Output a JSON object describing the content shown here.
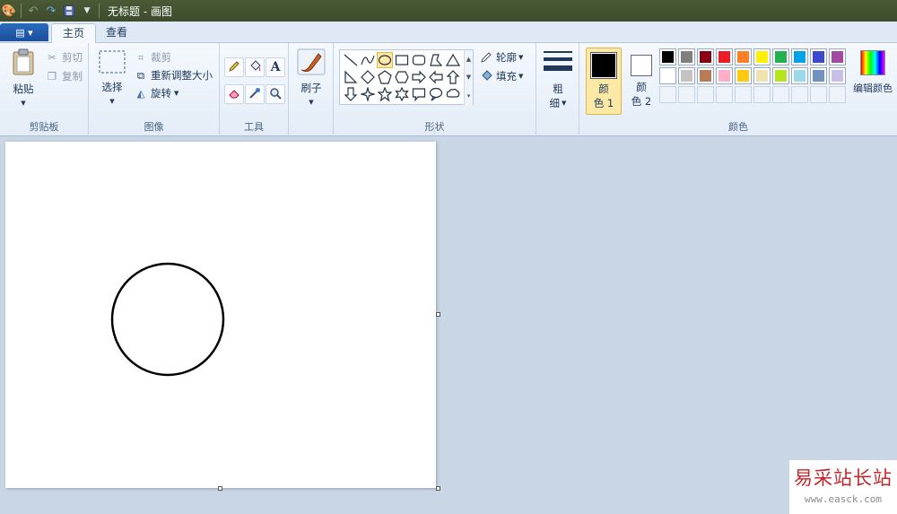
{
  "window": {
    "title": "无标题 - 画图"
  },
  "tabs": [
    {
      "label": "主页",
      "active": true
    },
    {
      "label": "查看",
      "active": false
    }
  ],
  "clipboard": {
    "paste_label": "粘贴",
    "cut_label": "剪切",
    "copy_label": "复制",
    "group_label": "剪贴板"
  },
  "image": {
    "select_label": "选择",
    "crop_label": "裁剪",
    "resize_label": "重新调整大小",
    "rotate_label": "旋转",
    "group_label": "图像"
  },
  "tools": {
    "group_label": "工具",
    "text_glyph": "A"
  },
  "brushes": {
    "label": "刷子"
  },
  "shapes": {
    "outline_label": "轮廓",
    "fill_label": "填充",
    "group_label": "形状",
    "selected": "oval"
  },
  "size": {
    "label_top": "粗",
    "label_bottom": "细"
  },
  "colors": {
    "color1_label_top": "颜",
    "color1_label_bottom": "色 1",
    "color2_label_top": "颜",
    "color2_label_bottom": "色 2",
    "color1_value": "#000000",
    "color2_value": "#ffffff",
    "edit_label": "编辑颜色",
    "group_label": "颜色",
    "palette_row1": [
      "#000000",
      "#7f7f7f",
      "#880015",
      "#ed1c24",
      "#ff7f27",
      "#fff200",
      "#22b14c",
      "#00a2e8",
      "#3f48cc",
      "#a349a4"
    ],
    "palette_row2": [
      "#ffffff",
      "#c3c3c3",
      "#b97a57",
      "#ffaec9",
      "#ffc90e",
      "#efe4b0",
      "#b5e61d",
      "#99d9ea",
      "#7092be",
      "#c8bfe7"
    ]
  },
  "watermark": {
    "title": "易采站长站",
    "url": "www.easck.com"
  }
}
